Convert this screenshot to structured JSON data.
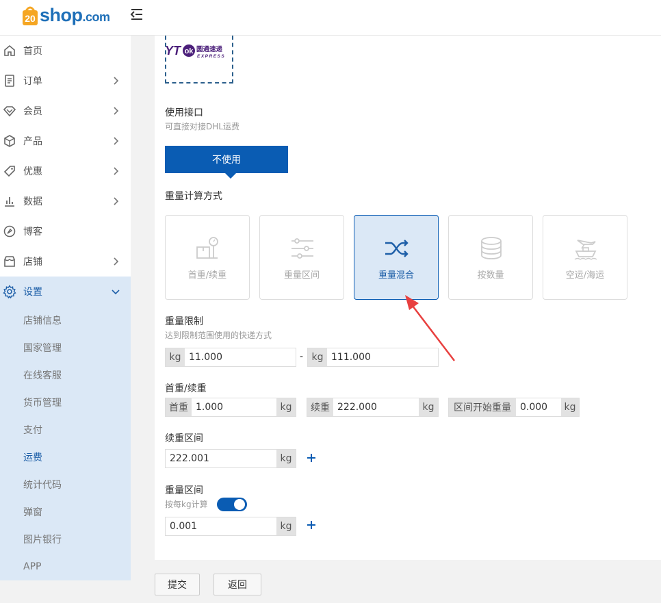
{
  "header": {
    "logo_prefix": "20",
    "logo_main": "shop",
    "logo_suffix": ".com"
  },
  "sidebar": {
    "items": [
      {
        "label": "首页",
        "icon": "home-icon"
      },
      {
        "label": "订单",
        "icon": "order-icon"
      },
      {
        "label": "会员",
        "icon": "member-icon"
      },
      {
        "label": "产品",
        "icon": "product-icon"
      },
      {
        "label": "优惠",
        "icon": "tag-icon"
      },
      {
        "label": "数据",
        "icon": "chart-icon"
      },
      {
        "label": "博客",
        "icon": "blog-icon"
      },
      {
        "label": "店铺",
        "icon": "store-icon"
      },
      {
        "label": "设置",
        "icon": "gear-icon"
      }
    ],
    "submenu": [
      "店铺信息",
      "国家管理",
      "在线客服",
      "货币管理",
      "支付",
      "运费",
      "统计代码",
      "弹窗",
      "图片银行",
      "APP"
    ]
  },
  "shipping": {
    "carrier_cn": "圆通速递",
    "carrier_en": "EXPRESS",
    "api_label": "使用接口",
    "api_hint": "可直接对接DHL运费",
    "api_button": "不使用",
    "method_label": "重量计算方式",
    "methods": [
      "首重/续重",
      "重量区间",
      "重量混合",
      "按数量",
      "空运/海运"
    ],
    "limit_label": "重量限制",
    "limit_hint": "达到限制范围使用的快递方式",
    "unit": "kg",
    "dash": "-",
    "limit_min": "11.000",
    "limit_max": "111.000",
    "first_cont_label": "首重/续重",
    "first_weight_label": "首重",
    "first_weight": "1.000",
    "cont_weight_label": "续重",
    "cont_weight": "222.000",
    "range_start_label": "区间开始重量",
    "range_start": "0.000",
    "cont_range_label": "续重区间",
    "cont_range_value": "222.001",
    "weight_range_label": "重量区间",
    "weight_range_hint": "按每kg计算",
    "weight_range_value": "0.001"
  },
  "footer": {
    "submit": "提交",
    "back": "返回"
  },
  "colors": {
    "primary": "#0a5cb3",
    "selected_bg": "#dbe8f6",
    "annotation_arrow": "#e8403f"
  }
}
